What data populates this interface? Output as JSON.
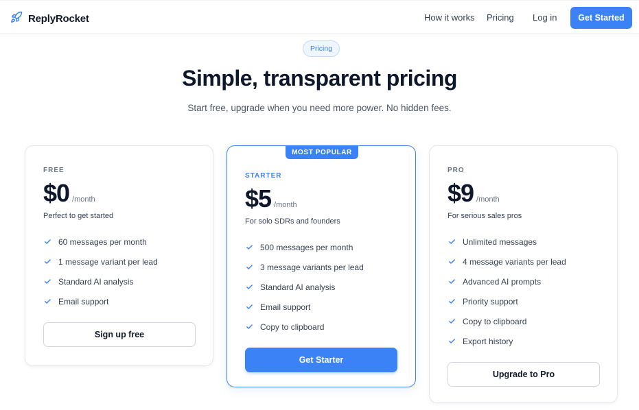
{
  "header": {
    "brand": "ReplyRocket",
    "brand_icon": "rocket-icon",
    "nav": [
      "How it works",
      "Pricing",
      "Log in"
    ],
    "cta": "Get Started"
  },
  "hero": {
    "pill": "Pricing",
    "title": "Simple, transparent pricing",
    "subtitle": "Start free, upgrade when you need more power. No hidden fees."
  },
  "plans": [
    {
      "tier": "FREE",
      "price": "$0",
      "period": "/month",
      "tagline": "Perfect to get started",
      "features": [
        "60 messages per month",
        "1 message variant per lead",
        "Standard AI analysis",
        "Email support"
      ],
      "button": "Sign up free"
    },
    {
      "badge": "MOST POPULAR",
      "tier": "STARTER",
      "price": "$5",
      "period": "/month",
      "tagline": "For solo SDRs and founders",
      "features": [
        "500 messages per month",
        "3 message variants per lead",
        "Standard AI analysis",
        "Email support",
        "Copy to clipboard"
      ],
      "button": "Get Starter"
    },
    {
      "tier": "PRO",
      "price": "$9",
      "period": "/month",
      "tagline": "For serious sales pros",
      "features": [
        "Unlimited messages",
        "4 message variants per lead",
        "Advanced AI prompts",
        "Priority support",
        "Copy to clipboard",
        "Export history"
      ],
      "button": "Upgrade to Pro"
    }
  ],
  "colors": {
    "accent": "#3b82f6",
    "text": "#0f172a",
    "muted": "#6b7280",
    "check": "#3b82f6"
  }
}
